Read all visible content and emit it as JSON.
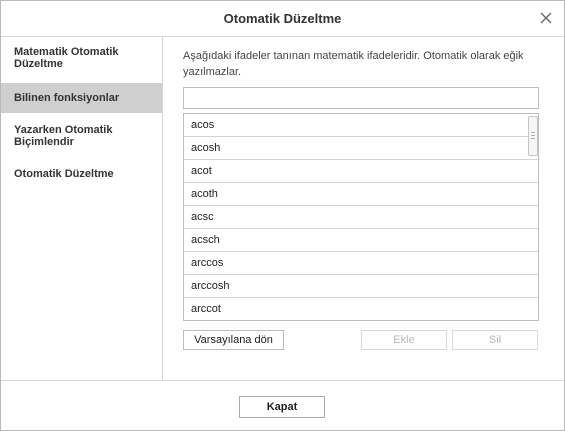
{
  "dialog": {
    "title": "Otomatik Düzeltme",
    "close_icon": "close-icon"
  },
  "sidebar": {
    "items": [
      {
        "label": "Matematik Otomatik Düzeltme",
        "active": false
      },
      {
        "label": "Bilinen fonksiyonlar",
        "active": true
      },
      {
        "label": "Yazarken Otomatik Biçimlendir",
        "active": false
      },
      {
        "label": "Otomatik Düzeltme",
        "active": false
      }
    ]
  },
  "main": {
    "description": "Aşağıdaki ifadeler tanınan matematik ifadeleridir. Otomatik olarak eğik yazılmazlar.",
    "search": {
      "value": "",
      "placeholder": ""
    },
    "functions": [
      "acos",
      "acosh",
      "acot",
      "acoth",
      "acsc",
      "acsch",
      "arccos",
      "arccosh",
      "arccot"
    ],
    "buttons": {
      "reset_label": "Varsayılana dön",
      "add_label": "Ekle",
      "delete_label": "Sil"
    }
  },
  "footer": {
    "close_label": "Kapat"
  }
}
